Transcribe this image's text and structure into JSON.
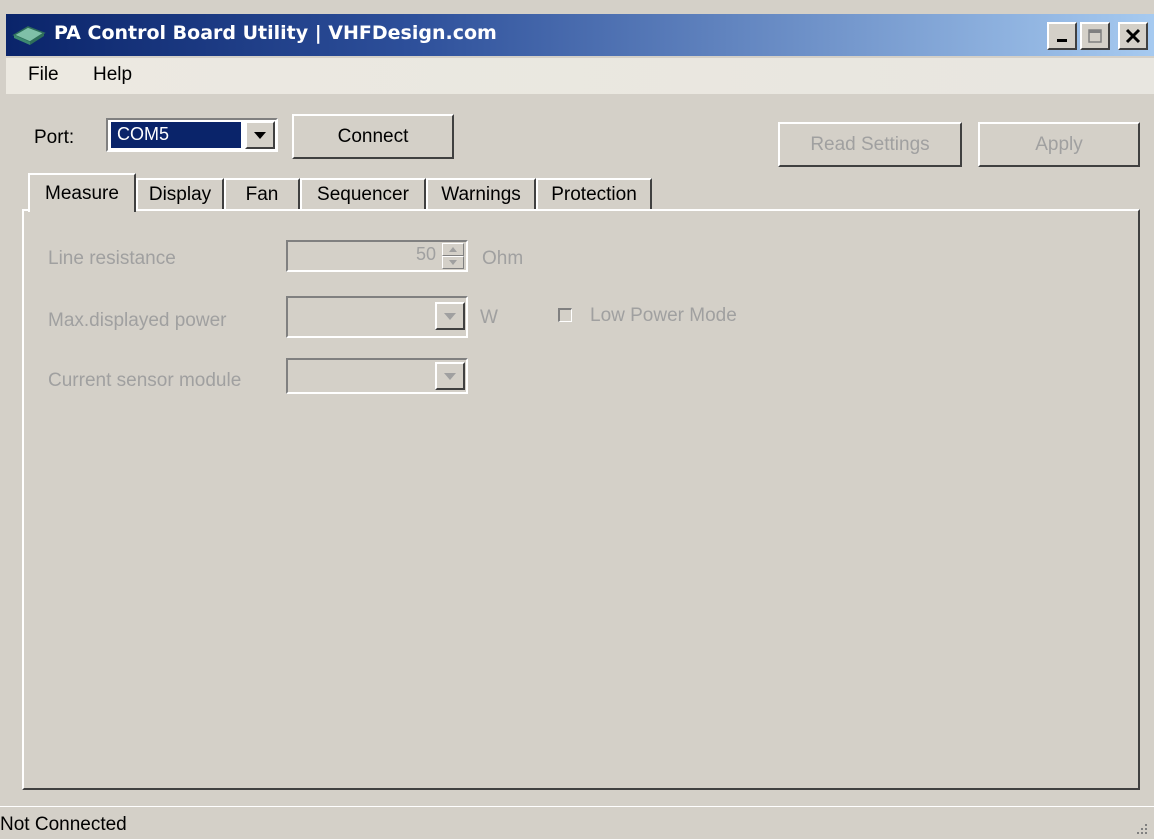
{
  "window": {
    "title": "PA Control Board Utility | VHFDesign.com",
    "app_icon": "rf-board-icon"
  },
  "menu": {
    "items": [
      {
        "label": "File"
      },
      {
        "label": "Help"
      }
    ]
  },
  "toolbar": {
    "port_label": "Port:",
    "port_value": "COM5",
    "connect_label": "Connect",
    "read_settings_label": "Read Settings",
    "apply_label": "Apply"
  },
  "tabs": [
    {
      "label": "Measure",
      "active": true
    },
    {
      "label": "Display"
    },
    {
      "label": "Fan"
    },
    {
      "label": "Sequencer"
    },
    {
      "label": "Warnings"
    },
    {
      "label": "Protection"
    }
  ],
  "measure": {
    "line_resistance_label": "Line resistance",
    "line_resistance_value": "50",
    "line_resistance_unit": "Ohm",
    "max_power_label": "Max.displayed power",
    "max_power_unit": "W",
    "low_power_mode_label": "Low Power Mode",
    "current_sensor_label": "Current sensor module"
  },
  "status": {
    "text": "Not Connected"
  },
  "colors": {
    "title_start": "#0a246a",
    "title_end": "#a6caf0",
    "face": "#d4d0c8",
    "selection": "#0a246a",
    "disabled_text": "#a0a0a0"
  }
}
